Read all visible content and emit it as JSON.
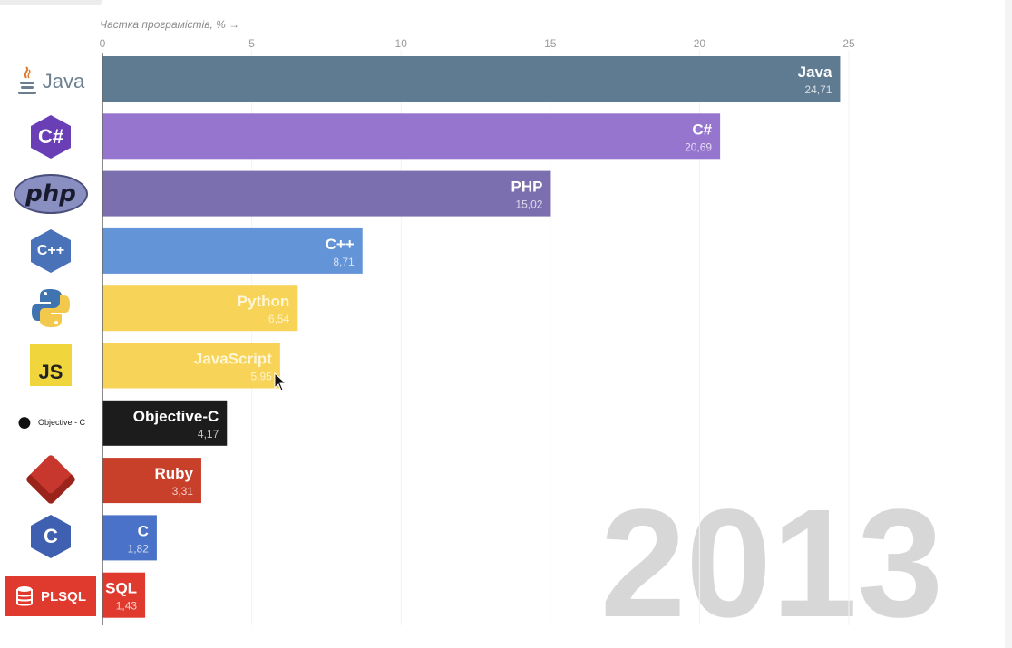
{
  "chart_data": {
    "type": "bar",
    "orientation": "horizontal",
    "x_axis_title": "Частка програмістів, % →",
    "xlim": [
      0,
      25
    ],
    "ticks": [
      0,
      5,
      10,
      15,
      20,
      25
    ],
    "year": "2013",
    "categories": [
      "Java",
      "C#",
      "PHP",
      "C++",
      "Python",
      "JavaScript",
      "Objective-C",
      "Ruby",
      "C",
      "SQL"
    ],
    "values": [
      24.71,
      20.69,
      15.02,
      8.71,
      6.54,
      5.95,
      4.17,
      3.31,
      1.82,
      1.43
    ],
    "value_labels": [
      "24,71",
      "20,69",
      "15,02",
      "8,71",
      "6,54",
      "5,95",
      "4,17",
      "3,31",
      "1,82",
      "1,43"
    ],
    "colors": [
      "#5f7b92",
      "#9575cd",
      "#7b6fb0",
      "#6394d8",
      "#f7d358",
      "#f7d358",
      "#1c1c1c",
      "#c8402a",
      "#4a72c8",
      "#e03a2e"
    ],
    "grid": false,
    "legend": "none"
  },
  "logos": [
    {
      "id": "java",
      "label": "Java",
      "icon": "java-icon"
    },
    {
      "id": "csharp",
      "label": "C#",
      "icon": "csharp-icon",
      "color": "#6a3fb5"
    },
    {
      "id": "php",
      "label": "php",
      "icon": "php-icon"
    },
    {
      "id": "cpp",
      "label": "C++",
      "icon": "cpp-icon",
      "color": "#4a72b8"
    },
    {
      "id": "python",
      "label": "",
      "icon": "python-icon"
    },
    {
      "id": "js",
      "label": "JS",
      "icon": "javascript-icon"
    },
    {
      "id": "objc",
      "label": "Objective - C",
      "icon": "apple-icon"
    },
    {
      "id": "ruby",
      "label": "",
      "icon": "ruby-icon"
    },
    {
      "id": "c",
      "label": "C",
      "icon": "c-icon",
      "color": "#3f5fb0"
    },
    {
      "id": "plsql",
      "label": "PLSQL",
      "icon": "database-icon"
    }
  ]
}
